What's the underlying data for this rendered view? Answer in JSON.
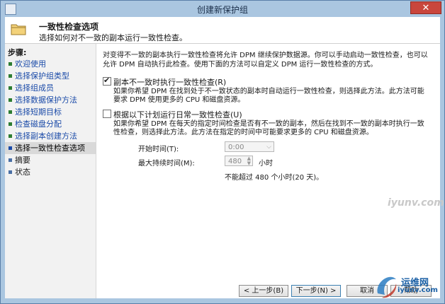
{
  "window": {
    "title": "创建新保护组",
    "close_label": "✕"
  },
  "header": {
    "title": "一致性检查选项",
    "subtitle": "选择如何对不一致的副本运行一致性检查。"
  },
  "sidebar": {
    "label": "步骤:",
    "items": [
      {
        "label": "欢迎使用",
        "state": "done"
      },
      {
        "label": "选择保护组类型",
        "state": "done"
      },
      {
        "label": "选择组成员",
        "state": "done"
      },
      {
        "label": "选择数据保护方法",
        "state": "done"
      },
      {
        "label": "选择短期目标",
        "state": "done"
      },
      {
        "label": "检查磁盘分配",
        "state": "done"
      },
      {
        "label": "选择副本创建方法",
        "state": "done"
      },
      {
        "label": "选择一致性检查选项",
        "state": "current"
      },
      {
        "label": "摘要",
        "state": "pending"
      },
      {
        "label": "状态",
        "state": "pending"
      }
    ]
  },
  "main": {
    "intro": "对变得不一致的副本执行一致性检查将允许 DPM 继续保护数据源。你可以手动启动一致性检查，也可以允许 DPM 自动执行此检查。使用下面的方法可以自定义 DPM 运行一致性检查的方式。",
    "option1": {
      "label": "副本不一致时执行一致性检查(R)",
      "checked": true,
      "description": "如果你希望 DPM 在找到处于不一致状态的副本时自动运行一致性检查，则选择此方法。此方法可能要求 DPM 使用更多的 CPU 和磁盘资源。"
    },
    "option2": {
      "label": "根据以下计划运行日常一致性检查(U)",
      "checked": false,
      "description": "如果你希望 DPM 在每天的指定时间检查是否有不一致的副本，然后在找到不一致的副本时执行一致性检查，则选择此方法。此方法在指定的时间中可能要求更多的 CPU 和磁盘资源。"
    },
    "start_time": {
      "label": "开始时间(T):",
      "value": "0:00"
    },
    "max_duration": {
      "label": "最大持续时间(M):",
      "value": "480",
      "unit": "小时"
    },
    "note": "不能超过 480 个小时(20 天)。"
  },
  "footer": {
    "back": "< 上一步(B)",
    "next": "下一步(N) >",
    "cancel": "取消",
    "help": "帮助"
  },
  "watermarks": {
    "site_name": "运维网",
    "site_url": "iyunv.com",
    "overlay": "iyunv.com"
  },
  "colors": {
    "accent": "#1a4aa8",
    "frame": "#aac6e0"
  }
}
